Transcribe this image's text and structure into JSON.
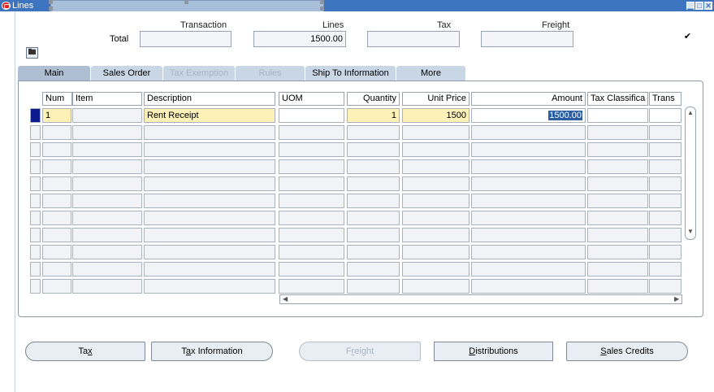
{
  "window": {
    "title": "Lines"
  },
  "header": {
    "total_label": "Total",
    "columns": [
      "Transaction",
      "Lines",
      "Tax",
      "Freight"
    ],
    "values": {
      "transaction": "",
      "lines": "1500.00",
      "tax": "",
      "freight": ""
    },
    "checkbox_checked": true
  },
  "tabs": [
    {
      "label": "Main",
      "state": "active"
    },
    {
      "label": "Sales Order",
      "state": "normal"
    },
    {
      "label": "Tax Exemption",
      "state": "disabled"
    },
    {
      "label": "Rules",
      "state": "disabled"
    },
    {
      "label": "Ship To Information",
      "state": "normal"
    },
    {
      "label": "More",
      "state": "normal"
    }
  ],
  "grid": {
    "columns": [
      "Num",
      "Item",
      "Description",
      "UOM",
      "Quantity",
      "Unit Price",
      "Amount",
      "Tax Classifica",
      "Trans"
    ],
    "rows": [
      {
        "num": "1",
        "item": "",
        "description": "Rent Receipt",
        "uom": "",
        "quantity": "1",
        "unit_price": "1500",
        "amount": "1500.00",
        "tax_classification": "",
        "trans": ""
      }
    ]
  },
  "buttons": [
    {
      "label": "Tax",
      "mnemonic_index": 2,
      "enabled": true
    },
    {
      "label": "Tax Information",
      "mnemonic_index": 1,
      "enabled": true
    },
    {
      "label": "Freight",
      "mnemonic_index": 1,
      "enabled": false
    },
    {
      "label": "Distributions",
      "mnemonic_index": 0,
      "enabled": true
    },
    {
      "label": "Sales Credits",
      "mnemonic_index": 0,
      "enabled": true
    }
  ],
  "colors": {
    "titlebar": "#3c74bf",
    "required_field": "#fdf1b8",
    "current_record": "#0d1a8c",
    "selection_highlight": "#2b5ea3",
    "disabled_text": "#a9b4c2"
  }
}
